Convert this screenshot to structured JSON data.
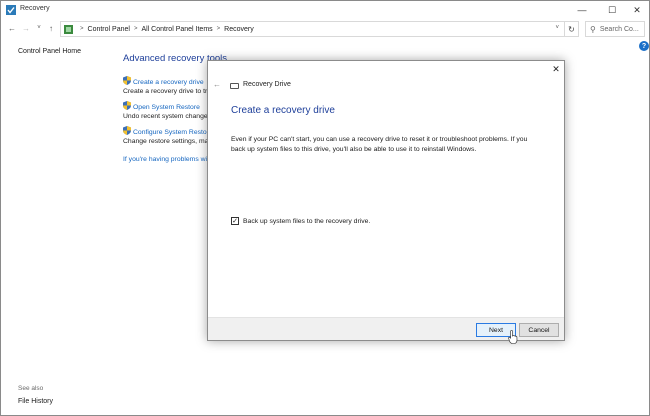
{
  "window": {
    "title": "Recovery",
    "minimize_glyph": "—",
    "maximize_glyph": "☐",
    "close_glyph": "✕"
  },
  "navbar": {
    "back_glyph": "←",
    "forward_glyph": "→",
    "recent_glyph": "˅",
    "up_glyph": "↑",
    "breadcrumbs": [
      "Control Panel",
      "All Control Panel Items",
      "Recovery"
    ],
    "separator": ">",
    "dropdown_glyph": "˅",
    "refresh_glyph": "↻",
    "search_placeholder": "Search Co..."
  },
  "help_glyph": "?",
  "left_pane": {
    "home_link": "Control Panel Home",
    "see_also_label": "See also",
    "see_also_items": [
      "File History"
    ]
  },
  "main": {
    "title": "Advanced recovery tools",
    "tools": [
      {
        "link": "Create a recovery drive",
        "description": "Create a recovery drive to troub"
      },
      {
        "link": "Open System Restore",
        "description": "Undo recent system changes,"
      },
      {
        "link": "Configure System Restore",
        "description": "Change restore settings, man"
      }
    ],
    "problems_link": "If you're having problems with"
  },
  "dialog": {
    "close_glyph": "✕",
    "back_glyph": "←",
    "app_title": "Recovery Drive",
    "heading": "Create a recovery drive",
    "body": "Even if your PC can't start, you can use a recovery drive to reset it or troubleshoot problems. If you back up system files to this drive, you'll also be able to use it to reinstall Windows.",
    "checkbox_label": "Back up system files to the recovery drive.",
    "checkbox_checked": true,
    "checkbox_glyph": "✓",
    "next_label": "Next",
    "cancel_label": "Cancel"
  },
  "colors": {
    "link": "#1566c0",
    "heading": "#1e3f9a",
    "accent": "#2a7ae2"
  }
}
